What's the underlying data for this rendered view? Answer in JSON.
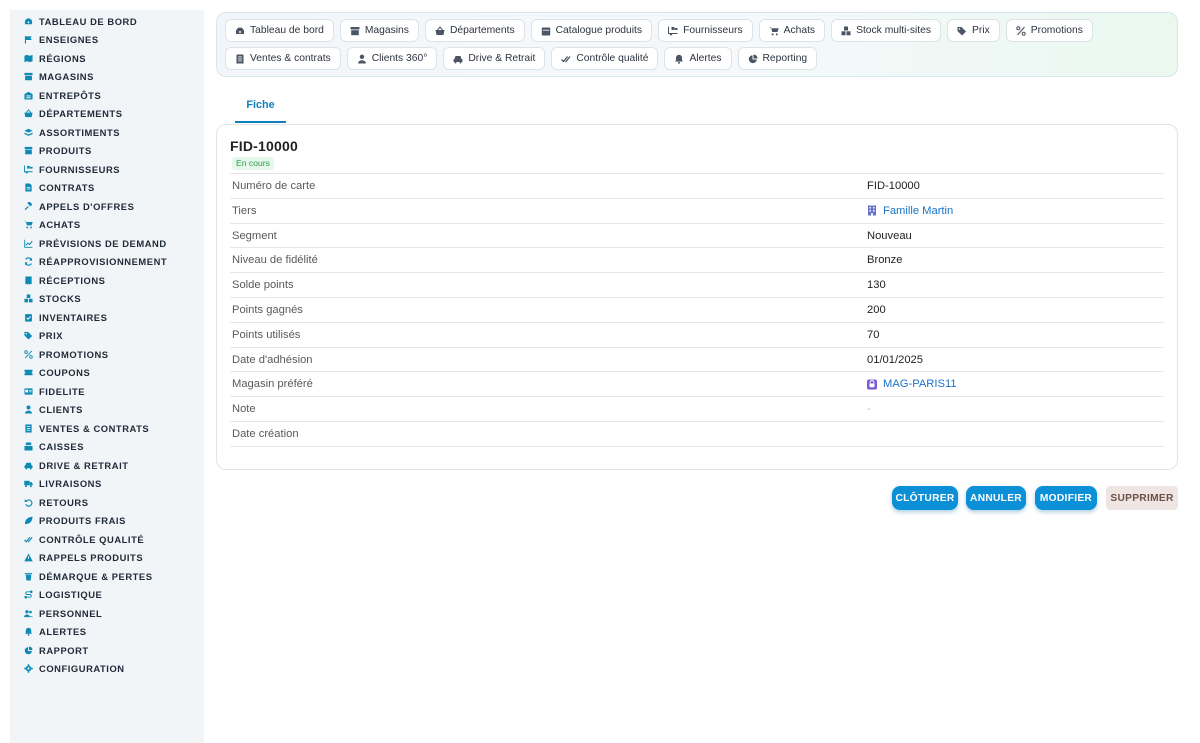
{
  "sidebar": {
    "items": [
      {
        "label": "TABLEAU DE BORD",
        "icon": "dashboard-icon"
      },
      {
        "label": "ENSEIGNES",
        "icon": "flag-icon"
      },
      {
        "label": "RÉGIONS",
        "icon": "map-icon"
      },
      {
        "label": "MAGASINS",
        "icon": "store-icon"
      },
      {
        "label": "ENTREPÔTS",
        "icon": "warehouse-icon"
      },
      {
        "label": "DÉPARTEMENTS",
        "icon": "basket-icon"
      },
      {
        "label": "ASSORTIMENTS",
        "icon": "layers-icon"
      },
      {
        "label": "PRODUITS",
        "icon": "box-icon"
      },
      {
        "label": "FOURNISSEURS",
        "icon": "truck-loading-icon"
      },
      {
        "label": "CONTRATS",
        "icon": "document-icon"
      },
      {
        "label": "APPELS D'OFFRES",
        "icon": "gavel-icon"
      },
      {
        "label": "ACHATS",
        "icon": "cart-icon"
      },
      {
        "label": "PRÉVISIONS DE DEMAND",
        "icon": "chart-line-icon"
      },
      {
        "label": "RÉAPPROVISIONNEMENT",
        "icon": "refresh-icon"
      },
      {
        "label": "RÉCEPTIONS",
        "icon": "receipt-icon"
      },
      {
        "label": "STOCKS",
        "icon": "boxes-icon"
      },
      {
        "label": "INVENTAIRES",
        "icon": "clipboard-check-icon"
      },
      {
        "label": "PRIX",
        "icon": "tags-icon"
      },
      {
        "label": "PROMOTIONS",
        "icon": "percent-icon"
      },
      {
        "label": "COUPONS",
        "icon": "ticket-icon"
      },
      {
        "label": "FIDELITE",
        "icon": "id-card-icon"
      },
      {
        "label": "CLIENTS",
        "icon": "user-icon"
      },
      {
        "label": "VENTES & CONTRATS",
        "icon": "receipt-list-icon"
      },
      {
        "label": "CAISSES",
        "icon": "cash-register-icon"
      },
      {
        "label": "DRIVE & RETRAIT",
        "icon": "car-icon"
      },
      {
        "label": "LIVRAISONS",
        "icon": "truck-icon"
      },
      {
        "label": "RETOURS",
        "icon": "undo-icon"
      },
      {
        "label": "PRODUITS FRAIS",
        "icon": "leaf-icon"
      },
      {
        "label": "CONTRÔLE QUALITÉ",
        "icon": "check-double-icon"
      },
      {
        "label": "RAPPELS PRODUITS",
        "icon": "warning-icon"
      },
      {
        "label": "DÉMARQUE & PERTES",
        "icon": "trash-icon"
      },
      {
        "label": "LOGISTIQUE",
        "icon": "route-icon"
      },
      {
        "label": "PERSONNEL",
        "icon": "users-icon"
      },
      {
        "label": "ALERTES",
        "icon": "bell-icon"
      },
      {
        "label": "RAPPORT",
        "icon": "pie-chart-icon"
      },
      {
        "label": "CONFIGURATION",
        "icon": "gear-icon"
      }
    ]
  },
  "toolbar": {
    "row1": [
      {
        "label": "Tableau de bord",
        "icon": "dashboard-icon"
      },
      {
        "label": "Magasins",
        "icon": "store-icon"
      },
      {
        "label": "Départements",
        "icon": "basket-icon"
      },
      {
        "label": "Catalogue produits",
        "icon": "calendar-icon"
      },
      {
        "label": "Fournisseurs",
        "icon": "truck-loading-icon"
      },
      {
        "label": "Achats",
        "icon": "cart-icon"
      },
      {
        "label": "Stock multi-sites",
        "icon": "boxes-icon"
      },
      {
        "label": "Prix",
        "icon": "tags-icon"
      },
      {
        "label": "Promotions",
        "icon": "percent-icon"
      }
    ],
    "row2": [
      {
        "label": "Ventes & contrats",
        "icon": "receipt-list-icon"
      },
      {
        "label": "Clients 360°",
        "icon": "user-icon"
      },
      {
        "label": "Drive & Retrait",
        "icon": "car-icon"
      },
      {
        "label": "Contrôle qualité",
        "icon": "check-double-icon"
      },
      {
        "label": "Alertes",
        "icon": "bell-icon"
      },
      {
        "label": "Reporting",
        "icon": "pie-chart-icon"
      }
    ]
  },
  "tabs": {
    "fiche": "Fiche"
  },
  "record": {
    "title": "FID-10000",
    "status": "En cours",
    "fields": [
      {
        "label": "Numéro de carte",
        "value": "FID-10000"
      },
      {
        "label": "Tiers",
        "value": "Famille Martin",
        "link": true,
        "icon": "building-icon"
      },
      {
        "label": "Segment",
        "value": "Nouveau"
      },
      {
        "label": "Niveau de fidélité",
        "value": "Bronze"
      },
      {
        "label": "Solde points",
        "value": "130"
      },
      {
        "label": "Points gagnés",
        "value": "200"
      },
      {
        "label": "Points utilisés",
        "value": "70"
      },
      {
        "label": "Date d'adhésion",
        "value": "01/01/2025"
      },
      {
        "label": "Magasin préféré",
        "value": "MAG-PARIS11",
        "link": true,
        "icon": "store-badge-icon"
      },
      {
        "label": "Note",
        "value": "-",
        "muted": true
      },
      {
        "label": "Date création",
        "value": ""
      }
    ]
  },
  "actions": {
    "cloturer": "CLÔTURER",
    "annuler": "ANNULER",
    "modifier": "MODIFIER",
    "supprimer": "SUPPRIMER"
  },
  "colors": {
    "accent": "#0b8fd6",
    "sidebar_icon": "#0f8ab5",
    "link": "#1a73c9",
    "badge_bg": "#e6f7ec",
    "badge_text": "#2c9b4c"
  }
}
